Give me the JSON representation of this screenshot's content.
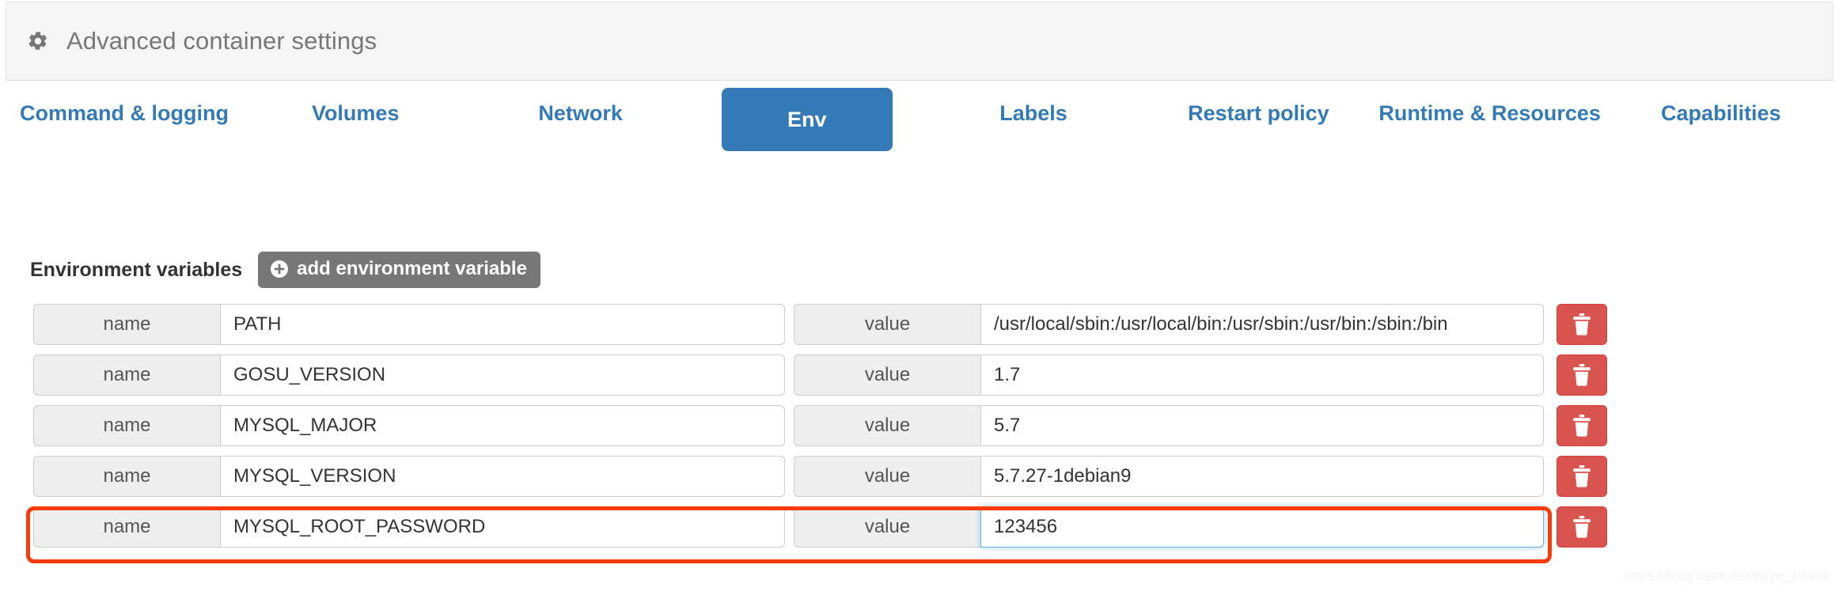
{
  "header": {
    "icon": "gear-icon",
    "title": "Advanced container settings"
  },
  "tabs": [
    {
      "label": "Command & logging",
      "active": false
    },
    {
      "label": "Volumes",
      "active": false
    },
    {
      "label": "Network",
      "active": false
    },
    {
      "label": "Env",
      "active": true
    },
    {
      "label": "Labels",
      "active": false
    },
    {
      "label": "Restart policy",
      "active": false
    },
    {
      "label": "Runtime & Resources",
      "active": false
    },
    {
      "label": "Capabilities",
      "active": false
    }
  ],
  "env_section": {
    "heading": "Environment variables",
    "add_button_label": "add environment variable",
    "add_button_icon": "plus-circle-icon",
    "name_addon_label": "name",
    "value_addon_label": "value",
    "delete_icon": "trash-icon",
    "variables": [
      {
        "name": "PATH",
        "value": "/usr/local/sbin:/usr/local/bin:/usr/sbin:/usr/bin:/sbin:/bin",
        "focused": false,
        "highlighted": false
      },
      {
        "name": "GOSU_VERSION",
        "value": "1.7",
        "focused": false,
        "highlighted": false
      },
      {
        "name": "MYSQL_MAJOR",
        "value": "5.7",
        "focused": false,
        "highlighted": false
      },
      {
        "name": "MYSQL_VERSION",
        "value": "5.7.27-1debian9",
        "focused": false,
        "highlighted": false
      },
      {
        "name": "MYSQL_ROOT_PASSWORD",
        "value": "123456",
        "focused": true,
        "highlighted": true
      }
    ]
  },
  "annotation": {
    "color": "#fa3c0c",
    "targets_row_index": 4
  },
  "watermark": "https://blog.csdn.net/iteye_10432",
  "colors": {
    "tab_link": "#337ab7",
    "tab_active_bg": "#337ab7",
    "add_button_bg": "#777777",
    "delete_button_bg": "#d9534f",
    "focus_border": "#66afe9",
    "panel_heading_bg": "#f5f5f5",
    "addon_bg": "#eeeeee"
  }
}
